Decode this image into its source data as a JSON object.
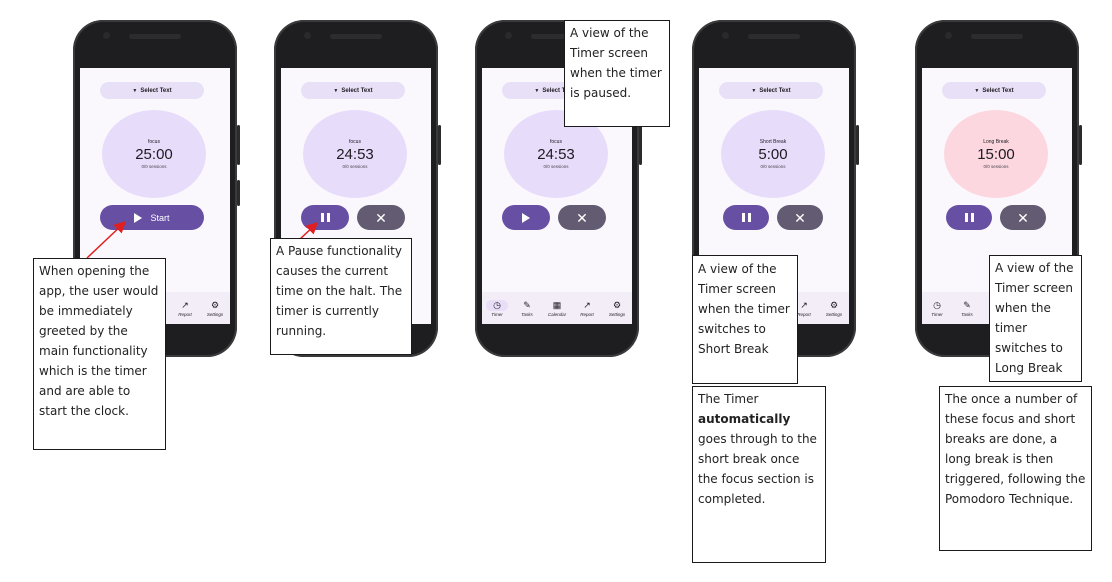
{
  "screens": [
    {
      "select_label": "Select Text",
      "mode": "focus",
      "time": "25:00",
      "sessions": "0/0 sessions",
      "primary_button": "Start",
      "primary_icon": "play-icon",
      "nav": [
        {
          "label": "Report",
          "icon": "trending-up-icon"
        },
        {
          "label": "Settings",
          "icon": "gear-icon"
        }
      ]
    },
    {
      "select_label": "Select Text",
      "mode": "focus",
      "time": "24:53",
      "sessions": "0/0 sessions",
      "primary_icon": "pause-icon",
      "secondary_icon": "close-icon"
    },
    {
      "select_label": "Select Text",
      "mode": "focus",
      "time": "24:53",
      "sessions": "0/0 sessions",
      "primary_icon": "play-icon",
      "secondary_icon": "close-icon",
      "nav": [
        {
          "label": "Timer",
          "icon": "clock-icon"
        },
        {
          "label": "Tasks",
          "icon": "pencil-icon"
        },
        {
          "label": "Calendar",
          "icon": "calendar-icon"
        },
        {
          "label": "Report",
          "icon": "trending-up-icon"
        },
        {
          "label": "Settings",
          "icon": "gear-icon"
        }
      ]
    },
    {
      "select_label": "Select Text",
      "mode": "Short Break",
      "time": "5:00",
      "sessions": "0/0 sessions",
      "primary_icon": "pause-icon",
      "secondary_icon": "close-icon",
      "nav": [
        {
          "label": "Report",
          "icon": "trending-up-icon"
        },
        {
          "label": "Settings",
          "icon": "gear-icon"
        }
      ]
    },
    {
      "select_label": "Select Text",
      "mode": "Long Break",
      "time": "15:00",
      "sessions": "0/0 sessions",
      "primary_icon": "pause-icon",
      "secondary_icon": "close-icon",
      "nav": [
        {
          "label": "Timer",
          "icon": "clock-icon"
        },
        {
          "label": "Tasks",
          "icon": "pencil-icon"
        }
      ]
    }
  ],
  "annotations": {
    "note1": "When opening the app, the user would be immediately greeted by the main functionality which is the timer and are able to start the clock.",
    "note2": "A Pause functionality causes the current time on the halt. The timer is currently running.",
    "note3": "A view of the Timer screen when the timer is paused.",
    "note4": "A view of the Timer screen when the timer switches to Short Break",
    "note5_before": "The Timer",
    "note5_bold": "automatically",
    "note5_after": "goes through to the short break once the focus section is completed.",
    "note6": "A view of the Timer screen when the timer switches to Long Break",
    "note7": "The once a number of these focus and short breaks are done, a long break is then triggered, following the Pomodoro Technique."
  },
  "colors": {
    "primary": "#6750a4",
    "secondary": "#625b71",
    "focus_circle": "#e8dcfb",
    "long_break_circle": "#fcd7e0",
    "arrow": "#e02020"
  }
}
